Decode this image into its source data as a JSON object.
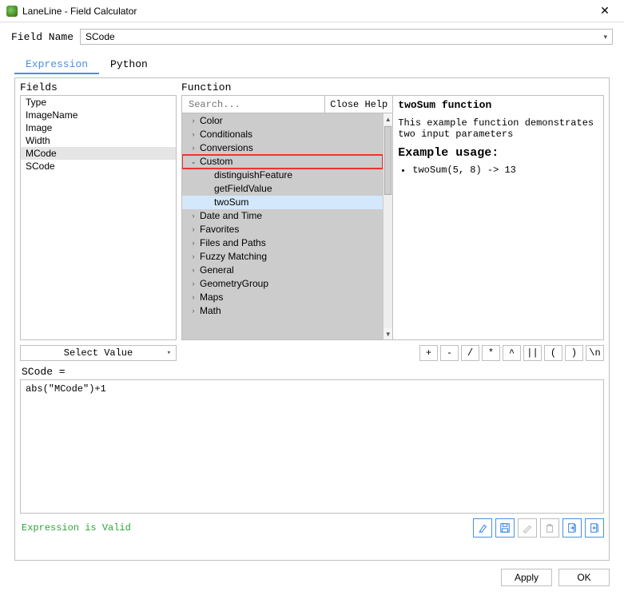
{
  "window": {
    "title": "LaneLine - Field Calculator"
  },
  "fieldname": {
    "label": "Field Name",
    "value": "SCode"
  },
  "tabs": {
    "expression": "Expression",
    "python": "Python"
  },
  "headers": {
    "fields": "Fields",
    "function": "Function",
    "search_placeholder": "Search...",
    "close_help": "Close Help"
  },
  "fields_list": [
    {
      "name": "Type",
      "selected": false
    },
    {
      "name": "ImageName",
      "selected": false
    },
    {
      "name": "Image",
      "selected": false
    },
    {
      "name": "Width",
      "selected": false
    },
    {
      "name": "MCode",
      "selected": true
    },
    {
      "name": "SCode",
      "selected": false
    }
  ],
  "select_value_label": "Select Value",
  "tree": [
    {
      "label": "Color",
      "expanded": false
    },
    {
      "label": "Conditionals",
      "expanded": false
    },
    {
      "label": "Conversions",
      "expanded": false
    },
    {
      "label": "Custom",
      "expanded": true,
      "highlight": true,
      "children": [
        {
          "label": "distinguishFeature"
        },
        {
          "label": "getFieldValue"
        },
        {
          "label": "twoSum",
          "selected": true
        }
      ]
    },
    {
      "label": "Date and Time",
      "expanded": false
    },
    {
      "label": "Favorites",
      "expanded": false
    },
    {
      "label": "Files and Paths",
      "expanded": false
    },
    {
      "label": "Fuzzy Matching",
      "expanded": false
    },
    {
      "label": "General",
      "expanded": false
    },
    {
      "label": "GeometryGroup",
      "expanded": false
    },
    {
      "label": "Maps",
      "expanded": false
    },
    {
      "label": "Math",
      "expanded": false
    }
  ],
  "help": {
    "title": "twoSum function",
    "desc": "This example function demonstrates two input parameters",
    "usage_heading": "Example usage:",
    "usage_item": "twoSum(5, 8) -> 13"
  },
  "operators": [
    "+",
    "-",
    "/",
    "*",
    "^",
    "||",
    "(",
    ")",
    "\\n"
  ],
  "expression": {
    "label": "SCode =",
    "text": "abs(\"MCode\")+1"
  },
  "status": {
    "valid": "Expression is Valid"
  },
  "buttons": {
    "apply": "Apply",
    "ok": "OK"
  }
}
